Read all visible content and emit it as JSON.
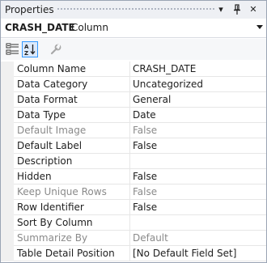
{
  "panel": {
    "title": "Properties",
    "buttons": {
      "dropdown": "▾",
      "pin": "⊥",
      "close": "✕"
    }
  },
  "object": {
    "name": "CRASH_DATE",
    "type": "Column"
  },
  "toolbar": {
    "icons": [
      "categorized-icon",
      "alphabetical-icon",
      "property-pages-icon"
    ]
  },
  "properties": [
    {
      "name": "Column Name",
      "value": "CRASH_DATE",
      "enabled": true
    },
    {
      "name": "Data Category",
      "value": "Uncategorized",
      "enabled": true
    },
    {
      "name": "Data Format",
      "value": "General",
      "enabled": true
    },
    {
      "name": "Data Type",
      "value": "Date",
      "enabled": true
    },
    {
      "name": "Default Image",
      "value": "False",
      "enabled": false
    },
    {
      "name": "Default Label",
      "value": "False",
      "enabled": true
    },
    {
      "name": "Description",
      "value": "",
      "enabled": true
    },
    {
      "name": "Hidden",
      "value": "False",
      "enabled": true
    },
    {
      "name": "Keep Unique Rows",
      "value": "False",
      "enabled": false
    },
    {
      "name": "Row Identifier",
      "value": "False",
      "enabled": true
    },
    {
      "name": "Sort By Column",
      "value": "",
      "enabled": true
    },
    {
      "name": "Summarize By",
      "value": "Default",
      "enabled": false
    },
    {
      "name": "Table Detail Position",
      "value": "[No Default Field Set]",
      "enabled": true
    }
  ]
}
